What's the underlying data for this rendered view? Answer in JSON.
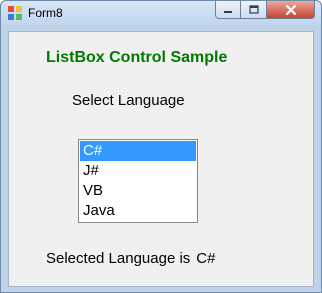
{
  "window": {
    "title": "Form8",
    "icon": "winforms-app-icon",
    "controls": {
      "minimize": "minimize-icon",
      "maximize": "maximize-icon",
      "close": "close-icon"
    }
  },
  "form": {
    "heading": "ListBox Control Sample",
    "heading_color": "#007a00",
    "select_label": "Select Language",
    "listbox": {
      "items": [
        "C#",
        "J#",
        "VB",
        "Java"
      ],
      "selected_index": 0,
      "selection_color": "#3399ff"
    },
    "status_label": "Selected Language is",
    "status_value": "C#"
  }
}
